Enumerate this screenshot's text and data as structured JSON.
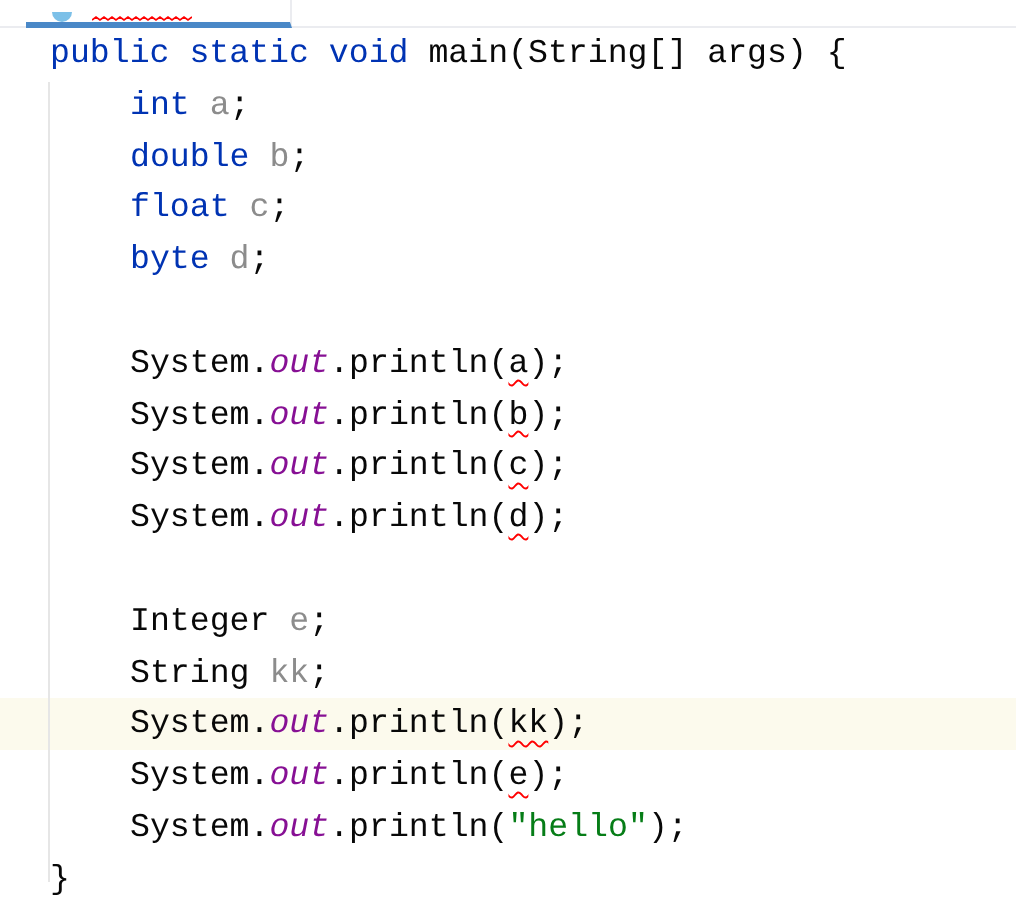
{
  "tab": {
    "selected": true,
    "has_error": true
  },
  "code_blocks": [
    [
      {
        "highlighted": false,
        "indent": false,
        "tokens": [
          {
            "kind": "keyword",
            "text": "public static void "
          },
          {
            "kind": "plain",
            "text": "main(String[] args) {"
          }
        ]
      },
      {
        "highlighted": false,
        "indent": true,
        "tokens": [
          {
            "kind": "keyword",
            "text": "int "
          },
          {
            "kind": "unused",
            "text": "a"
          },
          {
            "kind": "plain",
            "text": ";"
          }
        ]
      },
      {
        "highlighted": false,
        "indent": true,
        "tokens": [
          {
            "kind": "keyword",
            "text": "double "
          },
          {
            "kind": "unused",
            "text": "b"
          },
          {
            "kind": "plain",
            "text": ";"
          }
        ]
      },
      {
        "highlighted": false,
        "indent": true,
        "tokens": [
          {
            "kind": "keyword",
            "text": "float "
          },
          {
            "kind": "unused",
            "text": "c"
          },
          {
            "kind": "plain",
            "text": ";"
          }
        ]
      },
      {
        "highlighted": false,
        "indent": true,
        "tokens": [
          {
            "kind": "keyword",
            "text": "byte "
          },
          {
            "kind": "unused",
            "text": "d"
          },
          {
            "kind": "plain",
            "text": ";"
          }
        ]
      }
    ],
    [
      {
        "highlighted": false,
        "indent": true,
        "tokens": [
          {
            "kind": "plain",
            "text": "System."
          },
          {
            "kind": "field",
            "text": "out"
          },
          {
            "kind": "plain",
            "text": ".println("
          },
          {
            "kind": "error",
            "text": "a"
          },
          {
            "kind": "plain",
            "text": ");"
          }
        ]
      },
      {
        "highlighted": false,
        "indent": true,
        "tokens": [
          {
            "kind": "plain",
            "text": "System."
          },
          {
            "kind": "field",
            "text": "out"
          },
          {
            "kind": "plain",
            "text": ".println("
          },
          {
            "kind": "error",
            "text": "b"
          },
          {
            "kind": "plain",
            "text": ");"
          }
        ]
      },
      {
        "highlighted": false,
        "indent": true,
        "tokens": [
          {
            "kind": "plain",
            "text": "System."
          },
          {
            "kind": "field",
            "text": "out"
          },
          {
            "kind": "plain",
            "text": ".println("
          },
          {
            "kind": "error",
            "text": "c"
          },
          {
            "kind": "plain",
            "text": ");"
          }
        ]
      },
      {
        "highlighted": false,
        "indent": true,
        "tokens": [
          {
            "kind": "plain",
            "text": "System."
          },
          {
            "kind": "field",
            "text": "out"
          },
          {
            "kind": "plain",
            "text": ".println("
          },
          {
            "kind": "error",
            "text": "d"
          },
          {
            "kind": "plain",
            "text": ");"
          }
        ]
      }
    ],
    [
      {
        "highlighted": false,
        "indent": true,
        "tokens": [
          {
            "kind": "plain",
            "text": "Integer "
          },
          {
            "kind": "unused",
            "text": "e"
          },
          {
            "kind": "plain",
            "text": ";"
          }
        ]
      },
      {
        "highlighted": false,
        "indent": true,
        "tokens": [
          {
            "kind": "plain",
            "text": "String "
          },
          {
            "kind": "unused",
            "text": "kk"
          },
          {
            "kind": "plain",
            "text": ";"
          }
        ]
      },
      {
        "highlighted": true,
        "indent": true,
        "tokens": [
          {
            "kind": "plain",
            "text": "System."
          },
          {
            "kind": "field",
            "text": "out"
          },
          {
            "kind": "plain",
            "text": ".println("
          },
          {
            "kind": "error",
            "text": "kk"
          },
          {
            "kind": "plain",
            "text": ");"
          }
        ]
      },
      {
        "highlighted": false,
        "indent": true,
        "tokens": [
          {
            "kind": "plain",
            "text": "System."
          },
          {
            "kind": "field",
            "text": "out"
          },
          {
            "kind": "plain",
            "text": ".println("
          },
          {
            "kind": "error",
            "text": "e"
          },
          {
            "kind": "plain",
            "text": ");"
          }
        ]
      },
      {
        "highlighted": false,
        "indent": true,
        "tokens": [
          {
            "kind": "plain",
            "text": "System."
          },
          {
            "kind": "field",
            "text": "out"
          },
          {
            "kind": "plain",
            "text": ".println("
          },
          {
            "kind": "string",
            "text": "\"hello\""
          },
          {
            "kind": "plain",
            "text": ");"
          }
        ]
      },
      {
        "highlighted": false,
        "indent": false,
        "tokens": [
          {
            "kind": "plain",
            "text": "}"
          }
        ]
      }
    ]
  ]
}
